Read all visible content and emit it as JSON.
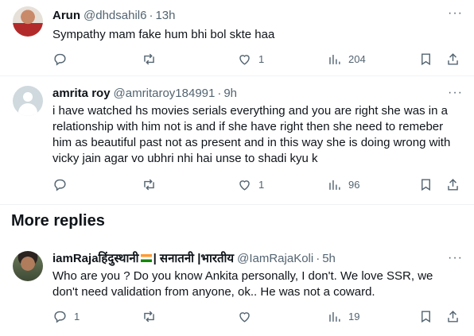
{
  "replies": [
    {
      "display_name": "Arun",
      "handle": "@dhdsahil6",
      "time": "13h",
      "text": "Sympathy mam fake hum bhi bol skte haa",
      "replies": "",
      "reposts": "",
      "likes": "1",
      "views": "204"
    },
    {
      "display_name": "amrita roy",
      "handle": "@amritaroy184991",
      "time": "9h",
      "text": "i have watched hs movies serials everything and you are right she was in a relationship with him not is and if she have right then she need to remeber him as beautiful past not as present and in this way she is doing wrong with vicky jain agar vo ubhri nhi hai unse to shadi kyu k",
      "replies": "",
      "reposts": "",
      "likes": "1",
      "views": "96"
    },
    {
      "display_name": "iamRajaहिंदुस्थानी",
      "display_name_extra": "| सनातनी |भारतीय",
      "handle": "@IamRajaKoli",
      "time": "5h",
      "text": "Who are you ? Do you know Ankita personally, I don't. We love SSR, we don't need validation from anyone, ok.. He was not a coward.",
      "replies": "1",
      "reposts": "",
      "likes": "",
      "views": "19"
    }
  ],
  "section_heading": "More replies",
  "more_glyph": "···",
  "dot": "·",
  "icons": [
    "reply-icon",
    "repost-icon",
    "like-icon",
    "views-icon",
    "bookmark-icon",
    "share-icon"
  ]
}
